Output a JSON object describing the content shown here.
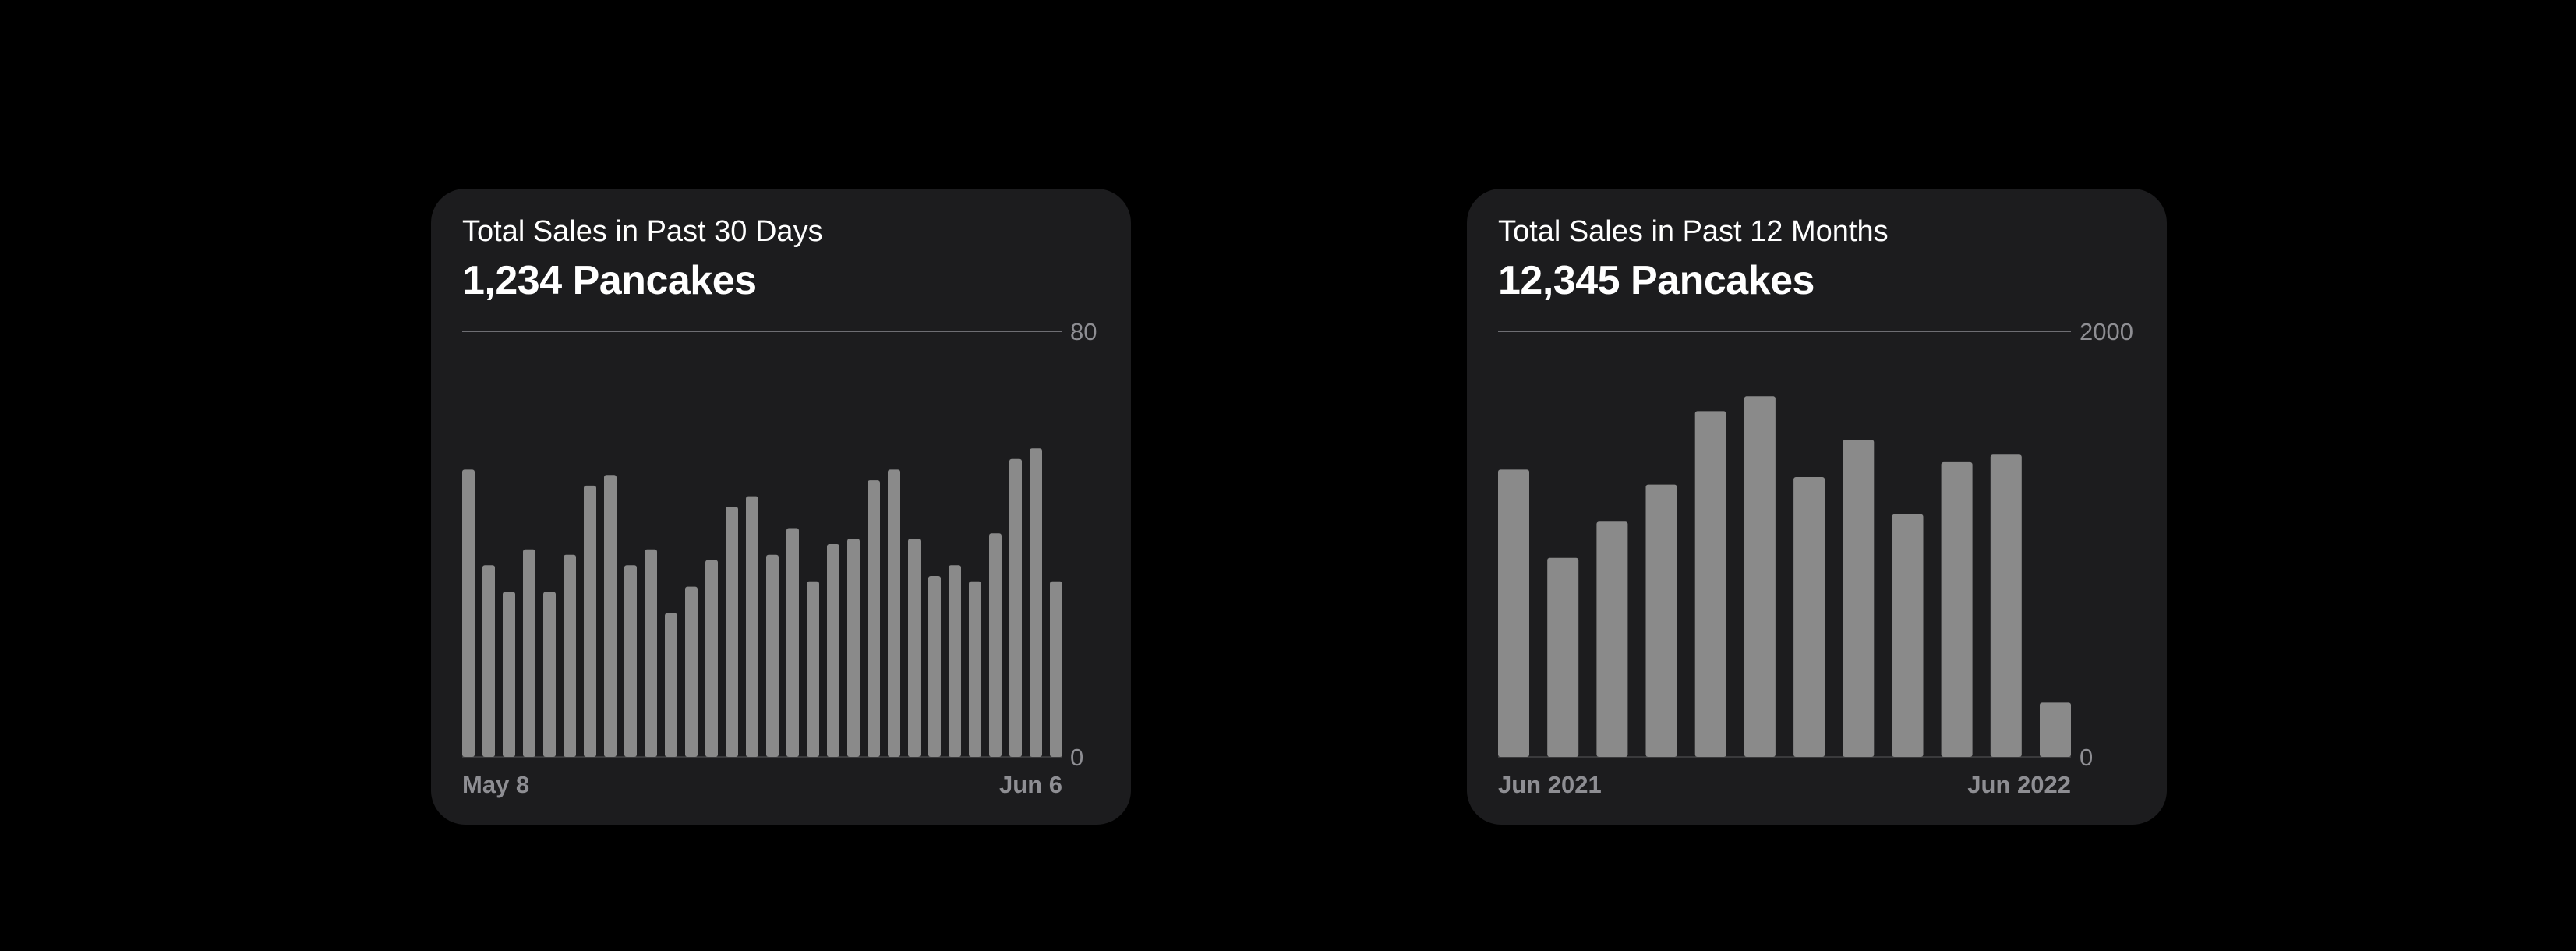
{
  "colors": {
    "background": "#000000",
    "card": "#1c1c1e",
    "bar": "#8a8a8a",
    "gridline": "#6e6e73",
    "tick_text": "#8e8e93",
    "text": "#ffffff"
  },
  "chart_data": [
    {
      "type": "bar",
      "subtitle": "Total Sales in Past 30 Days",
      "title": "1,234 Pancakes",
      "xlabel": "",
      "ylabel": "",
      "ylim": [
        0,
        80
      ],
      "yticks": [
        "80",
        "0"
      ],
      "xtick_labels": [
        "May 8",
        "Jun 6"
      ],
      "grid": "top gridline only",
      "values": [
        54,
        36,
        31,
        39,
        31,
        38,
        51,
        53,
        36,
        39,
        27,
        32,
        37,
        47,
        49,
        38,
        43,
        33,
        40,
        41,
        52,
        54,
        41,
        34,
        36,
        33,
        42,
        56,
        58,
        33
      ]
    },
    {
      "type": "bar",
      "subtitle": "Total Sales in Past 12 Months",
      "title": "12,345 Pancakes",
      "xlabel": "",
      "ylabel": "",
      "ylim": [
        0,
        2000
      ],
      "yticks": [
        "2000",
        "0"
      ],
      "xtick_labels": [
        "Jun 2021",
        "Jun 2022"
      ],
      "grid": "top gridline only",
      "values": [
        1350,
        935,
        1105,
        1280,
        1625,
        1695,
        1315,
        1490,
        1140,
        1385,
        1420,
        255
      ]
    }
  ]
}
